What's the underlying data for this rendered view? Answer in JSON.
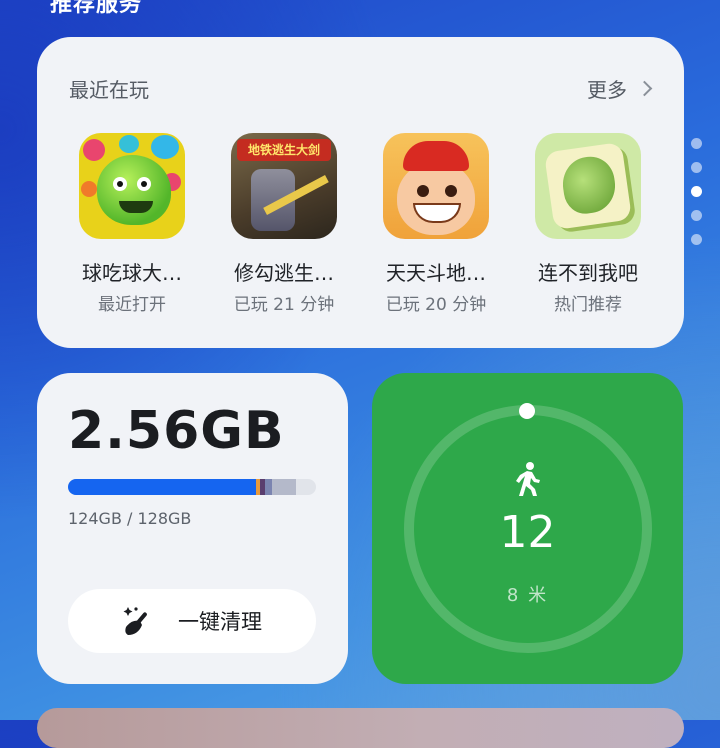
{
  "section_title": "推荐服务",
  "recent": {
    "title": "最近在玩",
    "more_label": "更多",
    "apps": [
      {
        "name": "球吃球大…",
        "subtitle": "最近打开",
        "icon": "green-blob-game-icon"
      },
      {
        "name": "修勾逃生…",
        "subtitle": "已玩 21 分钟",
        "icon": "subway-escape-game-icon",
        "icon_text": "地铁逃生大剑"
      },
      {
        "name": "天天斗地…",
        "subtitle": "已玩 20 分钟",
        "icon": "landlord-card-game-icon"
      },
      {
        "name": "连不到我吧",
        "subtitle": "热门推荐",
        "icon": "mahjong-connect-game-icon"
      }
    ]
  },
  "pager": {
    "count": 5,
    "active_index": 2
  },
  "storage": {
    "value": "2.56GB",
    "caption": "124GB / 128GB",
    "used_fraction": 0.78,
    "clean_label": "一键清理"
  },
  "steps": {
    "count": "12",
    "distance": "8 米"
  },
  "colors": {
    "storage_bar": "#1565f0",
    "steps_card": "#2ea84a",
    "card_bg": "#f1f3f7"
  }
}
